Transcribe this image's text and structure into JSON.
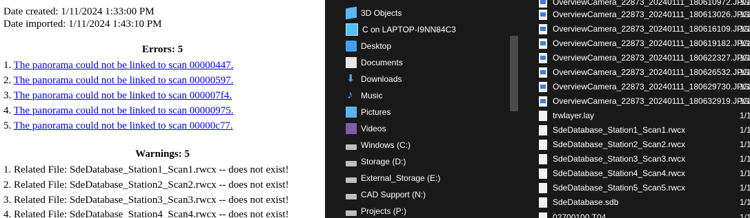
{
  "report": {
    "date_created": "Date created: 1/11/2024 1:33:00 PM",
    "date_imported": "Date imported: 1/11/2024 1:43:10 PM",
    "errors_heading": "Errors: 5",
    "errors": [
      {
        "num": "1.",
        "text": "The panorama could not be linked to scan 00000447."
      },
      {
        "num": "2.",
        "text": "The panorama could not be linked to scan 00000597."
      },
      {
        "num": "3.",
        "text": "The panorama could not be linked to scan 000007f4."
      },
      {
        "num": "4.",
        "text": "The panorama could not be linked to scan 00000975."
      },
      {
        "num": "5.",
        "text": "The panorama could not be linked to scan 00000c77."
      }
    ],
    "warnings_heading": "Warnings: 5",
    "warnings": [
      "1. Related File: SdeDatabase_Station1_Scan1.rwcx -- does not exist!",
      "2. Related File: SdeDatabase_Station2_Scan2.rwcx -- does not exist!",
      "3. Related File: SdeDatabase_Station3_Scan3.rwcx -- does not exist!",
      "4. Related File: SdeDatabase_Station4_Scan4.rwcx -- does not exist!"
    ]
  },
  "explorer": {
    "nav_items": [
      {
        "label": "3D Objects",
        "icon": "3d-objects-icon"
      },
      {
        "label": "C on LAPTOP-I9NN84C3",
        "icon": "network-drive-icon"
      },
      {
        "label": "Desktop",
        "icon": "desktop-folder-icon"
      },
      {
        "label": "Documents",
        "icon": "documents-icon"
      },
      {
        "label": "Downloads",
        "icon": "downloads-icon"
      },
      {
        "label": "Music",
        "icon": "music-icon"
      },
      {
        "label": "Pictures",
        "icon": "pictures-icon"
      },
      {
        "label": "Videos",
        "icon": "videos-icon"
      },
      {
        "label": "Windows (C:)",
        "icon": "drive-icon"
      },
      {
        "label": "Storage (D:)",
        "icon": "drive-icon"
      },
      {
        "label": "External_Storage (E:)",
        "icon": "drive-icon"
      },
      {
        "label": "CAD Support (N:)",
        "icon": "drive-icon"
      },
      {
        "label": "Projects (P:)",
        "icon": "drive-icon"
      }
    ],
    "files": [
      {
        "name": "OverviewCamera_22873_20240111_180610972.JPG",
        "type": "image",
        "date": "1/1"
      },
      {
        "name": "OverviewCamera_22873_20240111_180613026.JPG",
        "type": "image",
        "date": "1/1"
      },
      {
        "name": "OverviewCamera_22873_20240111_180616109.JPG",
        "type": "image",
        "date": "1/1"
      },
      {
        "name": "OverviewCamera_22873_20240111_180619182.JPG",
        "type": "image",
        "date": "1/1"
      },
      {
        "name": "OverviewCamera_22873_20240111_180622327.JPG",
        "type": "image",
        "date": "1/1"
      },
      {
        "name": "OverviewCamera_22873_20240111_180626532.JPG",
        "type": "image",
        "date": "1/1"
      },
      {
        "name": "OverviewCamera_22873_20240111_180629730.JPG",
        "type": "image",
        "date": "1/1"
      },
      {
        "name": "OverviewCamera_22873_20240111_180632919.JPG",
        "type": "image",
        "date": "1/1"
      },
      {
        "name": "trwlayer.lay",
        "type": "file",
        "date": "1/1"
      },
      {
        "name": "SdeDatabase_Station1_Scan1.rwcx",
        "type": "file",
        "date": "1/1"
      },
      {
        "name": "SdeDatabase_Station2_Scan2.rwcx",
        "type": "file",
        "date": "1/1"
      },
      {
        "name": "SdeDatabase_Station3_Scan3.rwcx",
        "type": "file",
        "date": "1/1"
      },
      {
        "name": "SdeDatabase_Station4_Scan4.rwcx",
        "type": "file",
        "date": "1/1"
      },
      {
        "name": "SdeDatabase_Station5_Scan5.rwcx",
        "type": "file",
        "date": "1/1"
      },
      {
        "name": "SdeDatabase.sdb",
        "type": "file",
        "date": "1/1"
      },
      {
        "name": "02700100.T04",
        "type": "file",
        "date": "1/1"
      }
    ]
  }
}
